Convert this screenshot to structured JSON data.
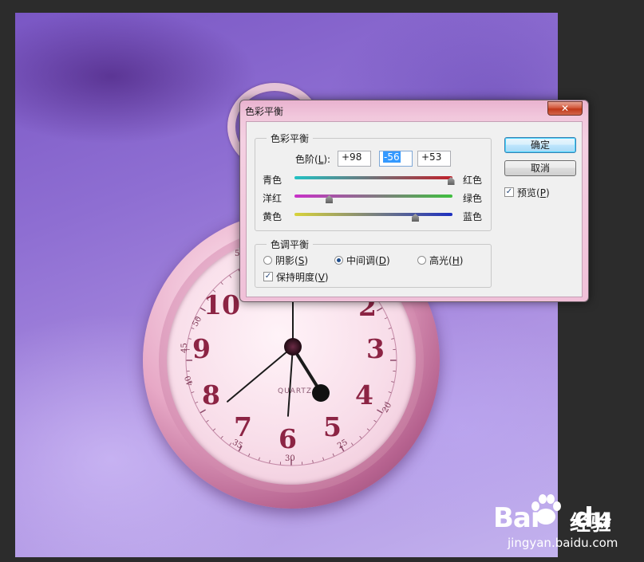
{
  "dialog": {
    "title": "色彩平衡",
    "close_label": "✕",
    "color_balance_group": "色彩平衡",
    "levels_label_prefix": "色阶(",
    "levels_label_key": "L",
    "levels_label_suffix": "):",
    "levels": [
      "+98",
      "-56",
      "+53"
    ],
    "sliders": [
      {
        "left_label": "青色",
        "right_label": "红色",
        "value": 98,
        "left_color": "#22c1c3",
        "right_color": "#c0202a"
      },
      {
        "left_label": "洋红",
        "right_label": "绿色",
        "value": -56,
        "left_color": "#c930c9",
        "right_color": "#3fbf3f"
      },
      {
        "left_label": "黄色",
        "right_label": "蓝色",
        "value": 53,
        "left_color": "#d8d33a",
        "right_color": "#1c2fc0"
      }
    ],
    "tone_balance_group": "色调平衡",
    "tones": [
      {
        "label": "阴影",
        "key": "S",
        "selected": false
      },
      {
        "label": "中间调",
        "key": "D",
        "selected": true
      },
      {
        "label": "高光",
        "key": "H",
        "selected": false
      }
    ],
    "preserve_luminosity": {
      "label": "保持明度",
      "key": "V",
      "checked": true
    },
    "ok_label": "确定",
    "cancel_label": "取消",
    "preview": {
      "label": "预览",
      "key": "P",
      "checked": true
    }
  },
  "clock": {
    "numerals": [
      "10",
      "9",
      "8",
      "7",
      "6",
      "5",
      "4",
      "3",
      "2"
    ],
    "small_numerals": [
      "5",
      "50",
      "45",
      "40",
      "35",
      "30",
      "25",
      "20"
    ],
    "brand": "QUARTZ"
  },
  "watermark": {
    "logo_a": "Bai",
    "logo_b": "du",
    "name": "经验",
    "url": "jingyan.baidu.com"
  }
}
